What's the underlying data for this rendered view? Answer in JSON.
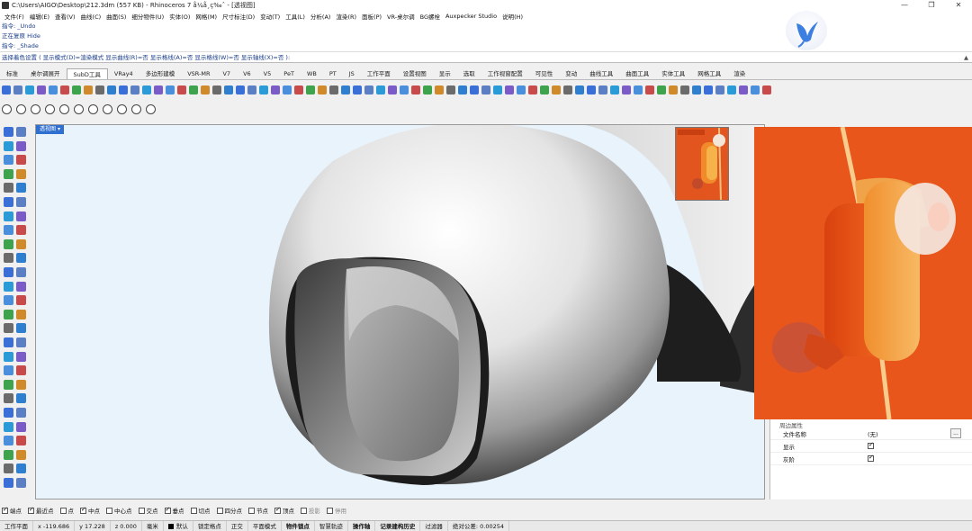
{
  "window": {
    "title": "C:\\Users\\AIGO\\Desktop\\212.3dm (557 KB) - Rhinoceros 7 å¼å¸ç‰ˆ - [透视图]",
    "controls": [
      "—",
      "❐",
      "✕"
    ]
  },
  "menu": [
    "文件(F)",
    "编辑(E)",
    "查看(V)",
    "曲线(C)",
    "曲面(S)",
    "细分物件(U)",
    "实体(O)",
    "网格(M)",
    "尺寸标注(D)",
    "变动(T)",
    "工具(L)",
    "分析(A)",
    "渲染(R)",
    "面板(P)",
    "VR-桌尔调",
    "BG螺栓",
    "Auxpecker Studio",
    "说明(H)"
  ],
  "command": {
    "history": [
      "指令: _Undo",
      "正在复原 Hide",
      "指令: _Shade"
    ],
    "prompt": "选择着色设置 ( 显示模式(D)=渲染模式  显示曲线(R)=否  显示格线(A)=否  显示格线(W)=否  显示轴线(X)=否 ):",
    "scroll_icon": "▲"
  },
  "tabs": [
    "标准",
    "桌尔调展开",
    "SubD工具",
    "VRay4",
    "多边形建模",
    "VSR-MR",
    "V7",
    "V6",
    "V5",
    "PeT",
    "WB",
    "PT",
    "JS",
    "工作平面",
    "设置视图",
    "显示",
    "选取",
    "工作视窗配置",
    "可见性",
    "变动",
    "曲线工具",
    "曲面工具",
    "实体工具",
    "网格工具",
    "渲染"
  ],
  "active_tab_index": 2,
  "viewport": {
    "label": "透视图",
    "dropdown_icon": "▾"
  },
  "properties": {
    "section_title": "周边属性",
    "rows": [
      {
        "name": "文件名称",
        "value": "(无)",
        "button": "..."
      },
      {
        "name": "显示",
        "checked": true
      },
      {
        "name": "灰阶",
        "checked": true
      }
    ]
  },
  "osnaps": [
    {
      "label": "端点",
      "checked": true
    },
    {
      "label": "最近点",
      "checked": true
    },
    {
      "label": "点",
      "checked": false
    },
    {
      "label": "中点",
      "checked": true
    },
    {
      "label": "中心点",
      "checked": false
    },
    {
      "label": "交点",
      "checked": false
    },
    {
      "label": "垂点",
      "checked": true
    },
    {
      "label": "切点",
      "checked": false
    },
    {
      "label": "四分点",
      "checked": false
    },
    {
      "label": "节点",
      "checked": false
    },
    {
      "label": "顶点",
      "checked": true
    },
    {
      "label": "投影",
      "checked": false,
      "disabled": true
    },
    {
      "label": "停用",
      "checked": false,
      "disabled": true
    }
  ],
  "status": {
    "cplane": "工作平面",
    "x": "x -119.686",
    "y": "y 17.228",
    "z": "z 0.000",
    "units": "毫米",
    "layer": "默认",
    "toggles": [
      "锁定格点",
      "正交",
      "平面模式",
      "物件锁点",
      "智慧轨迹",
      "操作轴",
      "记录建构历史",
      "过滤器"
    ],
    "bold_toggles": [
      "物件锁点",
      "操作轴",
      "记录建构历史"
    ],
    "tolerance": "绝对公差: 0.00254"
  },
  "colors": {
    "viewport_bg": "#e8f3fb",
    "viewport_label_bg": "#2f6fd0",
    "photo_orange": "#e8561c",
    "photo_yellow": "#f5a73c"
  }
}
